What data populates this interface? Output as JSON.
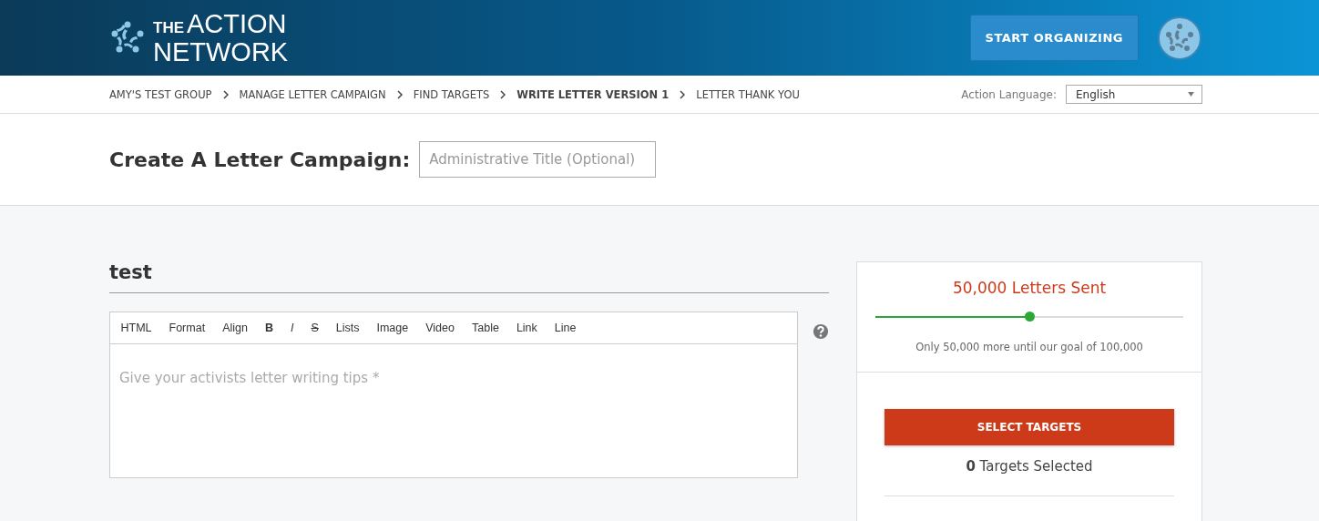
{
  "header": {
    "logo": {
      "small": "THE",
      "line_1": "ACTION",
      "line_2": "NETWORK"
    },
    "button": "START ORGANIZING"
  },
  "breadcrumbs": [
    {
      "label": "AMY'S TEST GROUP",
      "selected": false
    },
    {
      "label": "MANAGE LETTER CAMPAIGN",
      "selected": false
    },
    {
      "label": "FIND TARGETS",
      "selected": false
    },
    {
      "label": "WRITE LETTER VERSION 1",
      "selected": true
    },
    {
      "label": "LETTER THANK YOU",
      "selected": false
    }
  ],
  "language": {
    "label": "Action Language:",
    "value": "English"
  },
  "title": {
    "heading": "Create A Letter Campaign:",
    "placeholder": "Administrative Title (Optional)"
  },
  "letter": {
    "heading": "test",
    "toolbar": [
      {
        "label": "HTML",
        "kind": "text"
      },
      {
        "label": "Format",
        "kind": "text"
      },
      {
        "label": "Align",
        "kind": "text"
      },
      {
        "label": "B",
        "kind": "bold"
      },
      {
        "label": "I",
        "kind": "italic"
      },
      {
        "label": "S",
        "kind": "strike"
      },
      {
        "label": "Lists",
        "kind": "text"
      },
      {
        "label": "Image",
        "kind": "text"
      },
      {
        "label": "Video",
        "kind": "text"
      },
      {
        "label": "Table",
        "kind": "text"
      },
      {
        "label": "Link",
        "kind": "text"
      },
      {
        "label": "Line",
        "kind": "text"
      }
    ],
    "placeholder": "Give your activists letter writing tips *"
  },
  "progress": {
    "title": "50,000 Letters Sent",
    "level": 0.5,
    "note": "Only 50,000 more until our goal of 100,000"
  },
  "targets": {
    "button": "SELECT TARGETS",
    "count": "**0** Targets Selected"
  }
}
